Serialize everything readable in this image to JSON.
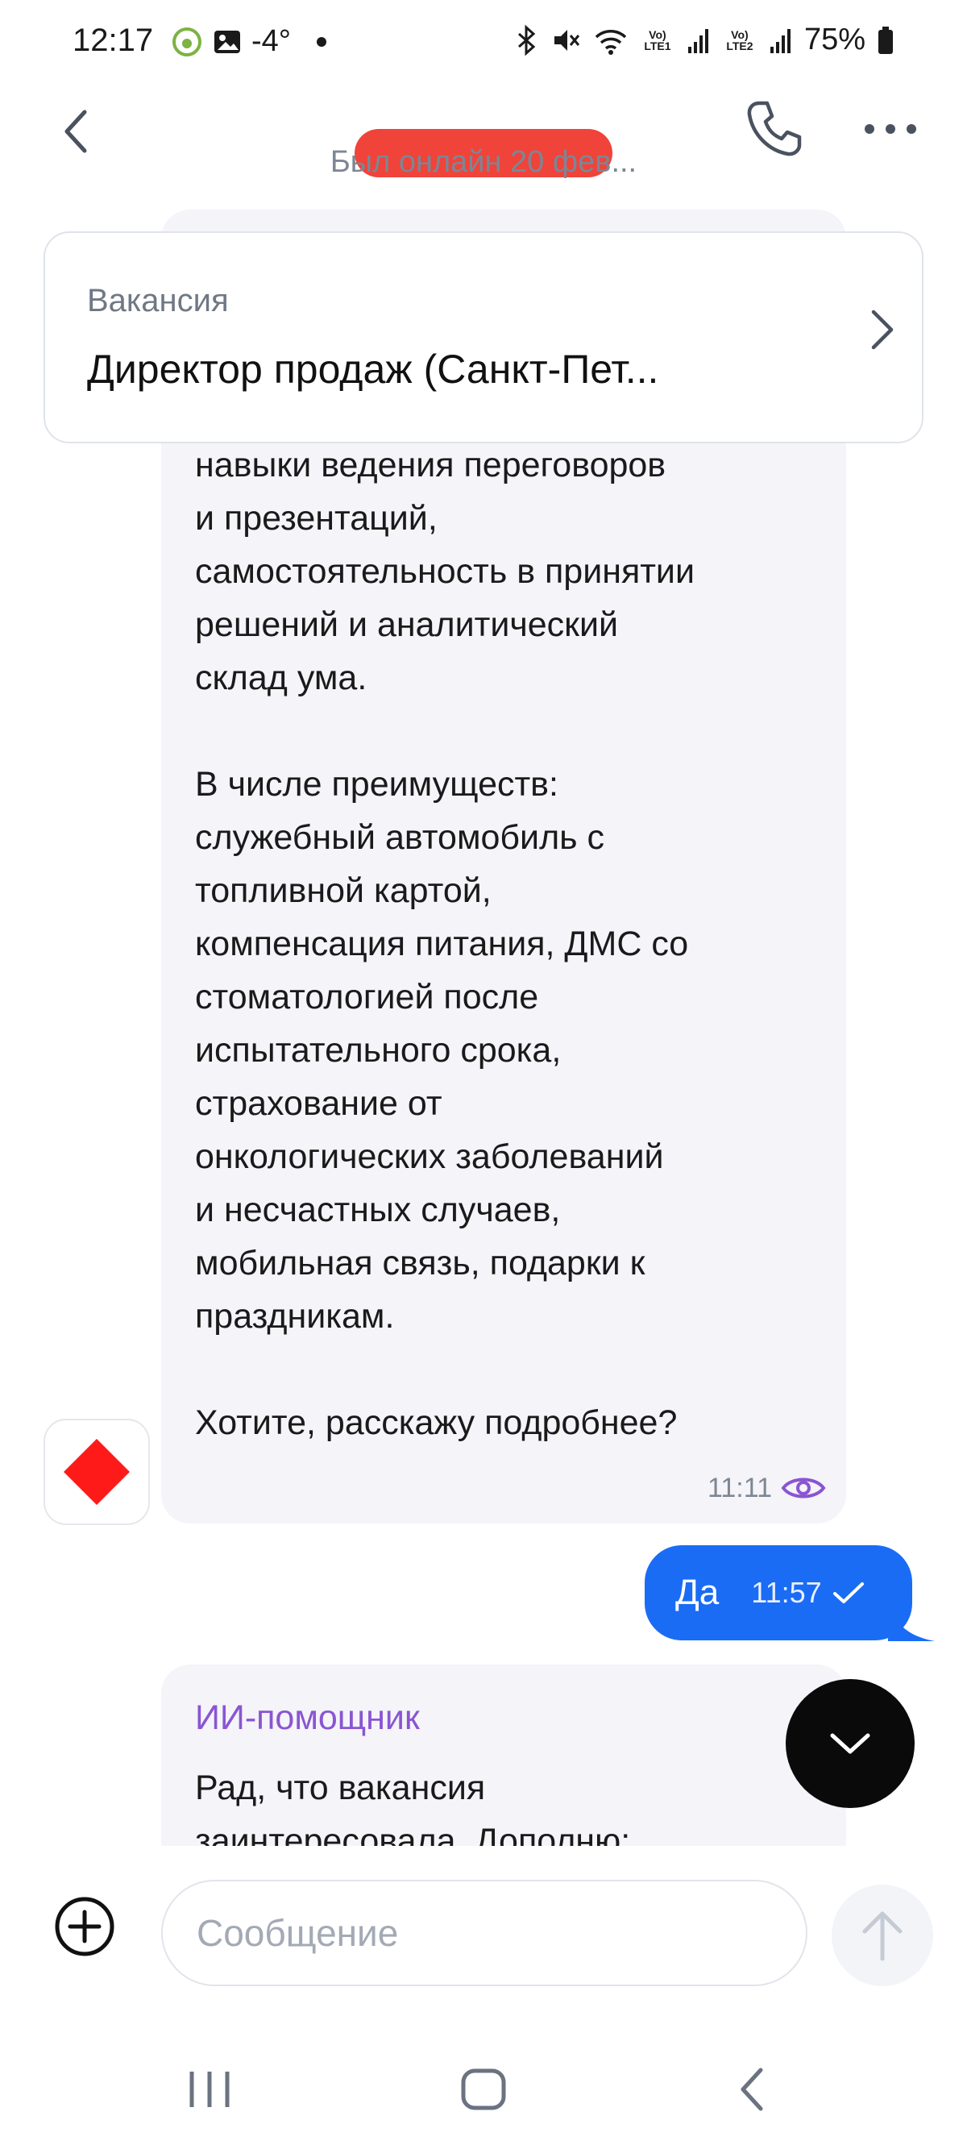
{
  "status_bar": {
    "time": "12:17",
    "temperature": "-4°",
    "lte1": "Vo) LTE1",
    "lte2": "Vo) LTE2",
    "battery": "75%"
  },
  "header": {
    "contact_status": "Был онлайн 20 фев..."
  },
  "vacancy": {
    "label": "Вакансия",
    "title": "Директор продаж (Санкт-Пет..."
  },
  "messages": {
    "incoming_1": {
      "text": "навыки ведения переговоров\nи презентаций,\nсамостоятельность в принятии\nрешений и аналитический\nсклад ума.\n\nВ числе преимуществ:\nслужебный автомобиль с\nтопливной картой,\nкомпенсация питания, ДМС со\nстоматологией после\nиспытательного срока,\nстрахование от\nонкологических заболеваний\nи несчастных случаев,\nмобильная связь, подарки к\nпраздникам.\n\nХотите, расскажу подробнее?",
      "time": "11:11"
    },
    "outgoing_1": {
      "text": "Да",
      "time": "11:57"
    },
    "incoming_2": {
      "sender": "ИИ-помощник",
      "text": "Рад, что вакансия\nзаинтересовала. Дополню:"
    }
  },
  "composer": {
    "placeholder": "Сообщение"
  },
  "colors": {
    "accent_blue": "#1a6cf5",
    "assistant_purple": "#8a55d2",
    "bubble_gray": "#f4f4f9",
    "redaction_red": "#f0433a",
    "avatar_red": "#ff1a1a"
  },
  "icons": {
    "back": "chevron-left-icon",
    "call": "phone-icon",
    "more": "more-dots-icon",
    "vacancy_open": "chevron-right-icon",
    "seen": "eye-icon",
    "delivered": "checkmark-icon",
    "scroll_down": "chevron-down-icon",
    "attach": "plus-circle-icon",
    "send": "arrow-up-icon"
  }
}
